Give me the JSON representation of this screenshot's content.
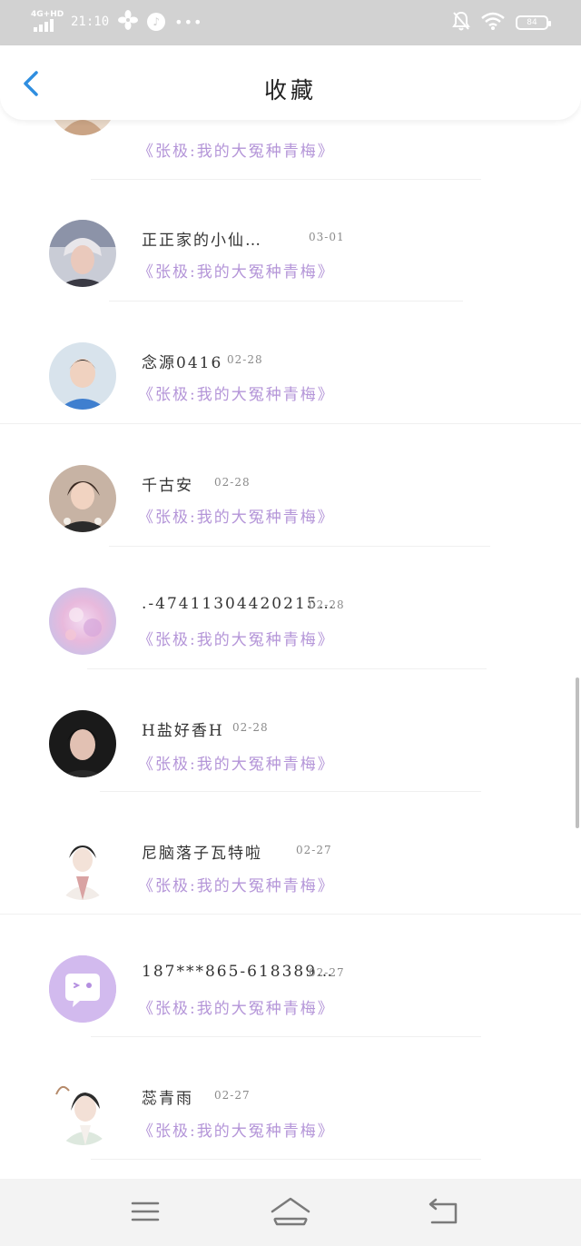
{
  "status_bar": {
    "network": "4G+HD",
    "time": "21:10",
    "battery": "84",
    "icons": [
      "fan-icon",
      "music-icon",
      "more-dots-icon",
      "mute-icon",
      "wifi-icon",
      "battery-icon"
    ]
  },
  "header": {
    "title": "收藏",
    "back_icon": "chevron-left-icon"
  },
  "entries": [
    {
      "name": "",
      "date": "",
      "title": "《张极:我的大冤种青梅》"
    },
    {
      "name": "正正家的小仙…",
      "date": "03-01",
      "title": "《张极:我的大冤种青梅》"
    },
    {
      "name": "念源0416",
      "date": "02-28",
      "title": "《张极:我的大冤种青梅》"
    },
    {
      "name": "千古安",
      "date": "02-28",
      "title": "《张极:我的大冤种青梅》"
    },
    {
      "name": ".-47411304420215…",
      "date": "02-28",
      "title": "《张极:我的大冤种青梅》"
    },
    {
      "name": "H盐好香H",
      "date": "02-28",
      "title": "《张极:我的大冤种青梅》"
    },
    {
      "name": "尼脑落子瓦特啦",
      "date": "02-27",
      "title": "《张极:我的大冤种青梅》"
    },
    {
      "name": "187***865-618389…",
      "date": "02-27",
      "title": "《张极:我的大冤种青梅》"
    },
    {
      "name": "蕊青雨",
      "date": "02-27",
      "title": "《张极:我的大冤种青梅》"
    }
  ],
  "nav": {
    "icons": [
      "menu-icon",
      "home-icon",
      "back-icon"
    ]
  },
  "colors": {
    "status_bar_bg": "#d2d2d2",
    "accent_blue": "#2f8ee0",
    "title_purple": "#b495d8",
    "nav_bg": "#f3f3f3"
  }
}
